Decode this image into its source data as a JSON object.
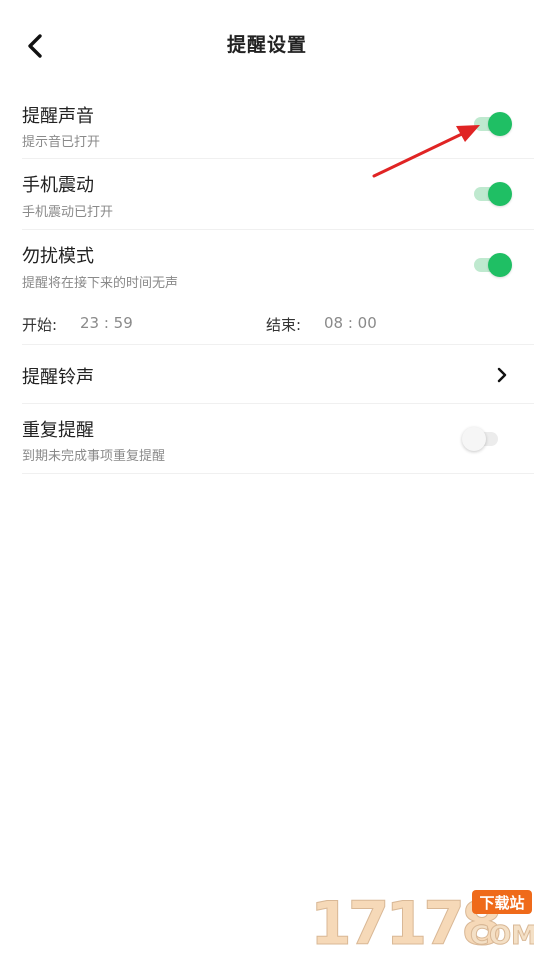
{
  "header": {
    "title": "提醒设置"
  },
  "settings": {
    "sound": {
      "title": "提醒声音",
      "subtitle": "提示音已打开",
      "enabled": true
    },
    "vibrate": {
      "title": "手机震动",
      "subtitle": "手机震动已打开",
      "enabled": true
    },
    "dnd": {
      "title": "勿扰模式",
      "subtitle": "提醒将在接下来的时间无声",
      "enabled": true
    },
    "ringtone": {
      "title": "提醒铃声"
    },
    "repeat": {
      "title": "重复提醒",
      "subtitle": "到期未完成事项重复提醒",
      "enabled": false
    }
  },
  "dnd_time": {
    "start_label": "开始:",
    "start_value": "23 : 59",
    "end_label": "结束:",
    "end_value": "08 : 00"
  },
  "colors": {
    "accent": "#1fbf64",
    "annotation_arrow": "#e02424"
  },
  "watermark": {
    "number": "17178",
    "tag": "下载站",
    "domain": "COM"
  }
}
